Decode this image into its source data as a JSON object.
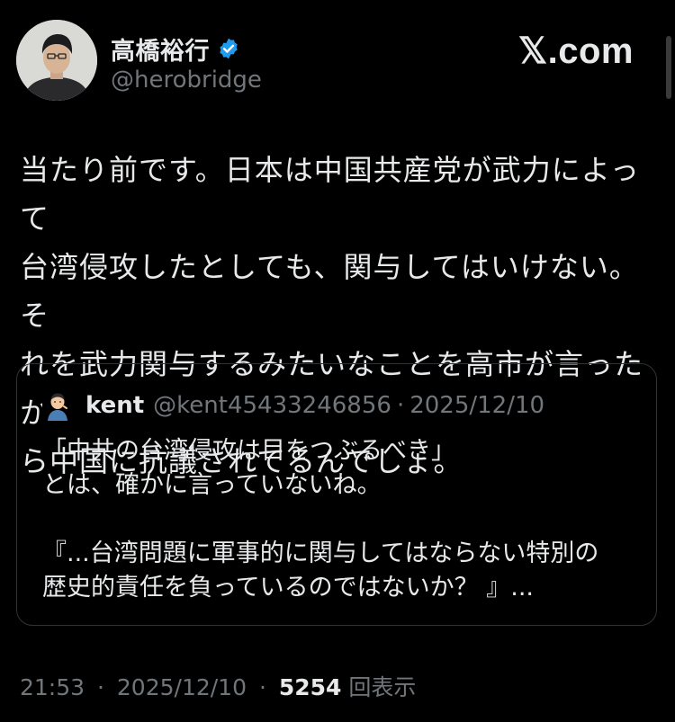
{
  "author": {
    "display_name": "高橋裕行",
    "handle": "@herobridge",
    "verified": true,
    "avatar": "person-photo-avatar"
  },
  "brand": {
    "label": "𝕏.com"
  },
  "tweet": {
    "text": "当たり前です。日本は中国共産党が武力によって\n台湾侵攻したとしても、関与してはいけない。そ\nれを武力関与するみたいなことを高市が言ったか\nら中国に抗議されてるんでしょ。"
  },
  "quoted_tweet": {
    "avatar": "cartoon-person-avatar",
    "display_name": "kent",
    "handle": "@kent45433246856",
    "separator": "·",
    "date": "2025/12/10",
    "text": "「中共の台湾侵攻は目をつぶるべき」\nとは、確かに言っていないね。\n\n『...台湾問題に軍事的に関与してはならない特別の\n歴史的責任を負っているのではないか？ 』..."
  },
  "meta": {
    "time": "21:53",
    "separator": "·",
    "date": "2025/12/10",
    "views_count": "5254",
    "views_label": "回表示"
  },
  "colors": {
    "background": "#000000",
    "text_primary": "#e7e9ea",
    "text_secondary": "#71767b",
    "border": "#2f3336",
    "verified_badge": "#1d9bf0"
  }
}
